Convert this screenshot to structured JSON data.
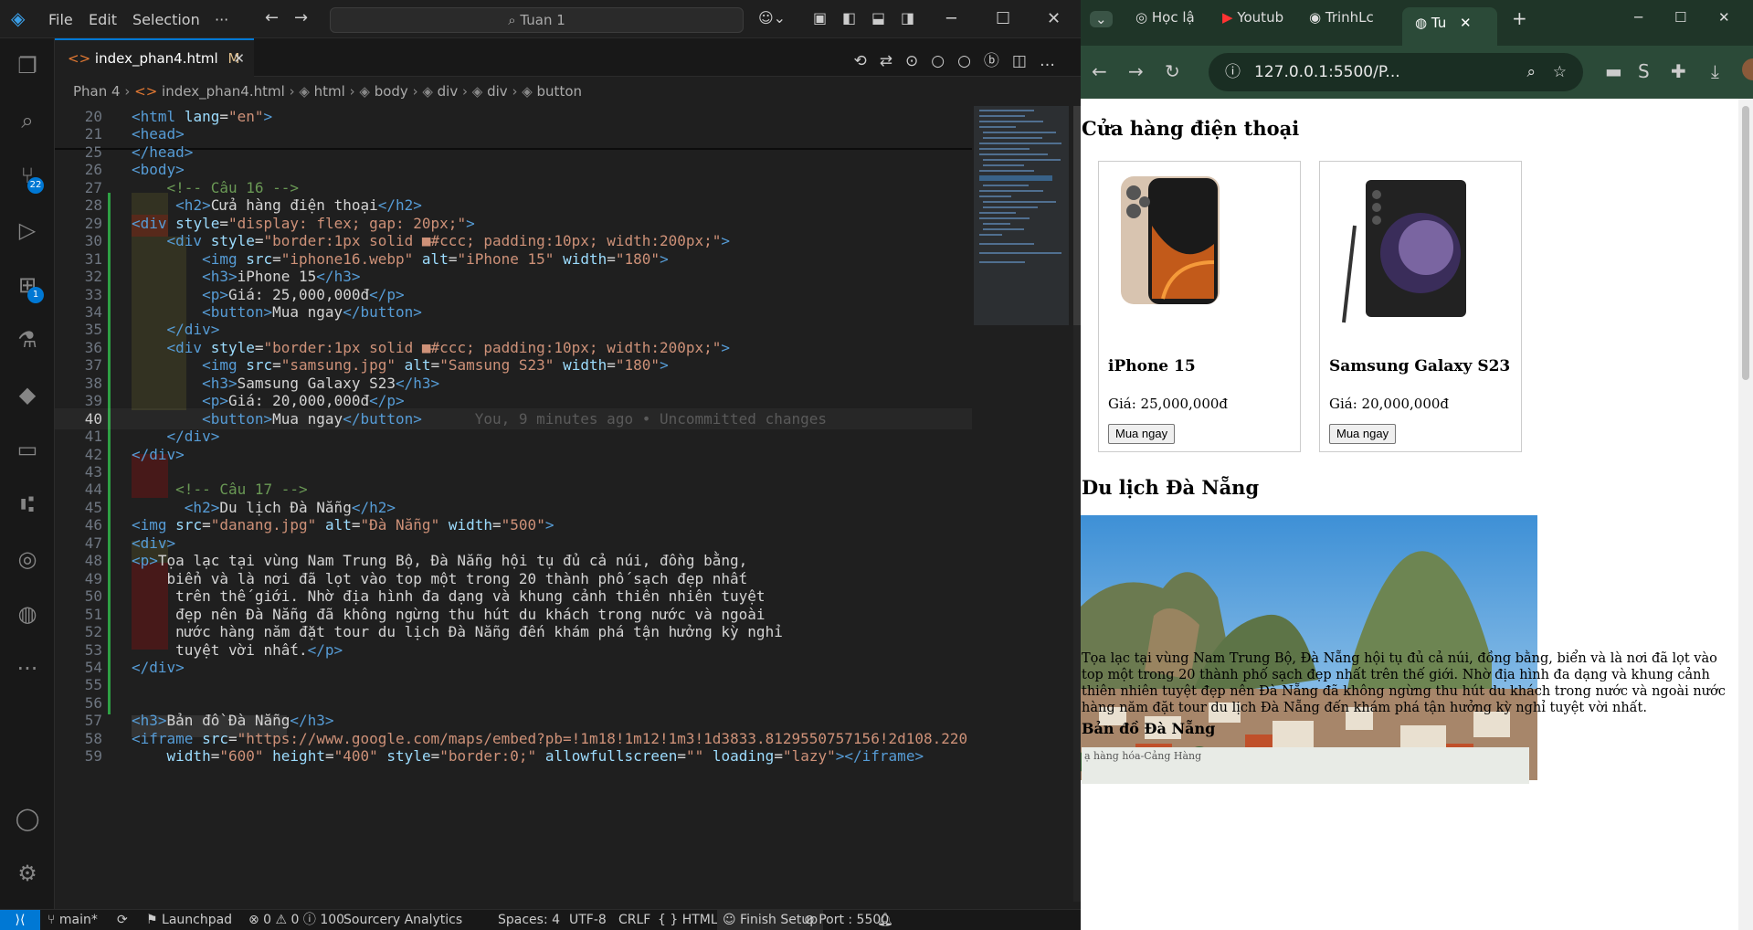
{
  "vscode": {
    "menu": [
      "File",
      "Edit",
      "Selection",
      "···"
    ],
    "search_text": "Tuan 1",
    "tab": {
      "label": "index_phan4.html",
      "modified": "M"
    },
    "breadcrumb": [
      "Phan 4",
      "index_phan4.html",
      "html",
      "body",
      "div",
      "div",
      "button"
    ],
    "activity_badges": {
      "source_control": "22",
      "extensions": "1"
    },
    "lines": [
      {
        "n": "20",
        "html": "<span class='t'>&lt;html</span> <span class='a'>lang</span>=<span class='s'>\"en\"</span><span class='t'>&gt;</span>"
      },
      {
        "n": "21",
        "html": "<span class='t'>&lt;head&gt;</span>"
      },
      {
        "n": "25",
        "html": "<span class='t'>&lt;/head&gt;</span>"
      },
      {
        "n": "26",
        "html": "<span class='t'>&lt;body&gt;</span>"
      },
      {
        "n": "27",
        "html": "    <span class='c'>&lt;!-- Câu 16 --&gt;</span>"
      },
      {
        "n": "28",
        "html": "     <span class='t'>&lt;h2&gt;</span>Cửa hàng điện thoại<span class='t'>&lt;/h2&gt;</span>"
      },
      {
        "n": "29",
        "html": "<span class='t'>&lt;div</span> <span class='a'>style</span>=<span class='s'>\"display: flex; gap: 20px;\"</span><span class='t'>&gt;</span>"
      },
      {
        "n": "30",
        "html": "    <span class='t'>&lt;div</span> <span class='a'>style</span>=<span class='s'>\"border:1px solid ■#ccc; padding:10px; width:200px;\"</span><span class='t'>&gt;</span>"
      },
      {
        "n": "31",
        "html": "        <span class='t'>&lt;img</span> <span class='a'>src</span>=<span class='s'>\"iphone16.webp\"</span> <span class='a'>alt</span>=<span class='s'>\"iPhone 15\"</span> <span class='a'>width</span>=<span class='s'>\"180\"</span><span class='t'>&gt;</span>"
      },
      {
        "n": "32",
        "html": "        <span class='t'>&lt;h3&gt;</span>iPhone 15<span class='t'>&lt;/h3&gt;</span>"
      },
      {
        "n": "33",
        "html": "        <span class='t'>&lt;p&gt;</span>Giá: 25,000,000đ<span class='t'>&lt;/p&gt;</span>"
      },
      {
        "n": "34",
        "html": "        <span class='t'>&lt;button&gt;</span>Mua ngay<span class='t'>&lt;/button&gt;</span>"
      },
      {
        "n": "35",
        "html": "    <span class='t'>&lt;/div&gt;</span>"
      },
      {
        "n": "36",
        "html": "    <span class='t'>&lt;div</span> <span class='a'>style</span>=<span class='s'>\"border:1px solid ■#ccc; padding:10px; width:200px;\"</span><span class='t'>&gt;</span>"
      },
      {
        "n": "37",
        "html": "        <span class='t'>&lt;img</span> <span class='a'>src</span>=<span class='s'>\"samsung.jpg\"</span> <span class='a'>alt</span>=<span class='s'>\"Samsung S23\"</span> <span class='a'>width</span>=<span class='s'>\"180\"</span><span class='t'>&gt;</span>"
      },
      {
        "n": "38",
        "html": "        <span class='t'>&lt;h3&gt;</span>Samsung Galaxy S23<span class='t'>&lt;/h3&gt;</span>"
      },
      {
        "n": "39",
        "html": "        <span class='t'>&lt;p&gt;</span>Giá: 20,000,000đ<span class='t'>&lt;/p&gt;</span>"
      },
      {
        "n": "40",
        "html": "        <span class='t'>&lt;button&gt;</span>Mua ngay<span class='t'>&lt;/button&gt;</span>      <span class='ann'>You, 9 minutes ago • Uncommitted changes</span>",
        "cur": true
      },
      {
        "n": "41",
        "html": "    <span class='t'>&lt;/div&gt;</span>"
      },
      {
        "n": "42",
        "html": "<span class='t'>&lt;/div&gt;</span>"
      },
      {
        "n": "43",
        "html": ""
      },
      {
        "n": "44",
        "html": "     <span class='c'>&lt;!-- Câu 17 --&gt;</span>"
      },
      {
        "n": "45",
        "html": "      <span class='t'>&lt;h2&gt;</span>Du lịch Đà Nẵng<span class='t'>&lt;/h2&gt;</span>"
      },
      {
        "n": "46",
        "html": "<span class='t'>&lt;img</span> <span class='a'>src</span>=<span class='s'>\"danang.jpg\"</span> <span class='a'>alt</span>=<span class='s'>\"Đà Nẵng\"</span> <span class='a'>width</span>=<span class='s'>\"500\"</span><span class='t'>&gt;</span>"
      },
      {
        "n": "47",
        "html": "<span class='t'>&lt;div&gt;</span>"
      },
      {
        "n": "48",
        "html": "<span class='t'>&lt;p&gt;</span>Tọa lạc tại vùng Nam Trung Bộ, Đà Nẵng hội tụ đủ cả núi, đồng bằng,"
      },
      {
        "n": "49",
        "html": "    biển và là nơi đã lọt vào top một trong 20 thành phố sạch đẹp nhất"
      },
      {
        "n": "50",
        "html": "     trên thế giới. Nhờ địa hình đa dạng và khung cảnh thiên nhiên tuyệt"
      },
      {
        "n": "51",
        "html": "     đẹp nên Đà Nẵng đã không ngừng thu hút du khách trong nước và ngoài"
      },
      {
        "n": "52",
        "html": "     nước hàng năm đặt tour du lịch Đà Nẵng đến khám phá tận hưởng kỳ nghỉ"
      },
      {
        "n": "53",
        "html": "     tuyệt vời nhất.<span class='t'>&lt;/p&gt;</span>"
      },
      {
        "n": "54",
        "html": "<span class='t'>&lt;/div&gt;</span>"
      },
      {
        "n": "55",
        "html": ""
      },
      {
        "n": "56",
        "html": ""
      },
      {
        "n": "57",
        "html": "<span class='t'>&lt;h3&gt;</span>Bản đồ Đà Nẵng<span class='t'>&lt;/h3&gt;</span>"
      },
      {
        "n": "58",
        "html": "<span class='t'>&lt;iframe</span> <span class='a'>src</span>=<span class='s'>\"https://www.google.com/maps/embed?pb=!1m18!1m12!1m3!1d3833.8129550757156!2d108.220</span>"
      },
      {
        "n": "59",
        "html": "    <span class='a'>width</span>=<span class='s'>\"600\"</span> <span class='a'>height</span>=<span class='s'>\"400\"</span> <span class='a'>style</span>=<span class='s'>\"border:0;\"</span> <span class='a'>allowfullscreen</span>=<span class='s'>\"\"</span> <span class='a'>loading</span>=<span class='s'>\"lazy\"</span><span class='t'>&gt;&lt;/iframe&gt;</span>"
      }
    ],
    "status": {
      "branch": "main*",
      "launchpad": "Launchpad",
      "problems": "⊗ 0 ⚠ 0 ⓘ 100",
      "sourcery": "Sourcery Analytics",
      "spaces": "Spaces: 4",
      "encoding": "UTF-8",
      "eol": "CRLF",
      "language": "{ } HTML",
      "finish_setup": "Finish Setup",
      "port": "Port : 5500"
    }
  },
  "browser": {
    "tabs": [
      "Học lậ",
      "Youtub",
      "TrinhLc",
      "Tu"
    ],
    "url": "127.0.0.1:5500/P...",
    "page": {
      "shop_title": "Cửa hàng điện thoại",
      "products": [
        {
          "name": "iPhone 15",
          "price": "Giá: 25,000,000đ",
          "button": "Mua ngay"
        },
        {
          "name": "Samsung Galaxy S23",
          "price": "Giá: 20,000,000đ",
          "button": "Mua ngay"
        }
      ],
      "travel_title": "Du lịch Đà Nẵng",
      "paragraph": "Tọa lạc tại vùng Nam Trung Bộ, Đà Nẵng hội tụ đủ cả núi, đồng bằng, biển và là nơi đã lọt vào top một trong 20 thành phố sạch đẹp nhất trên thế giới. Nhờ địa hình đa dạng và khung cảnh thiên nhiên tuyệt đẹp nên Đà Nẵng đã không ngừng thu hút du khách trong nước và ngoài nước hàng năm đặt tour du lịch Đà Nẵng đến khám phá tận hưởng kỳ nghỉ tuyệt vời nhất.",
      "map_title": "Bản đồ Đà Nẵng",
      "map_snippet": "ạ hàng hóa-Cảng Hàng"
    }
  }
}
